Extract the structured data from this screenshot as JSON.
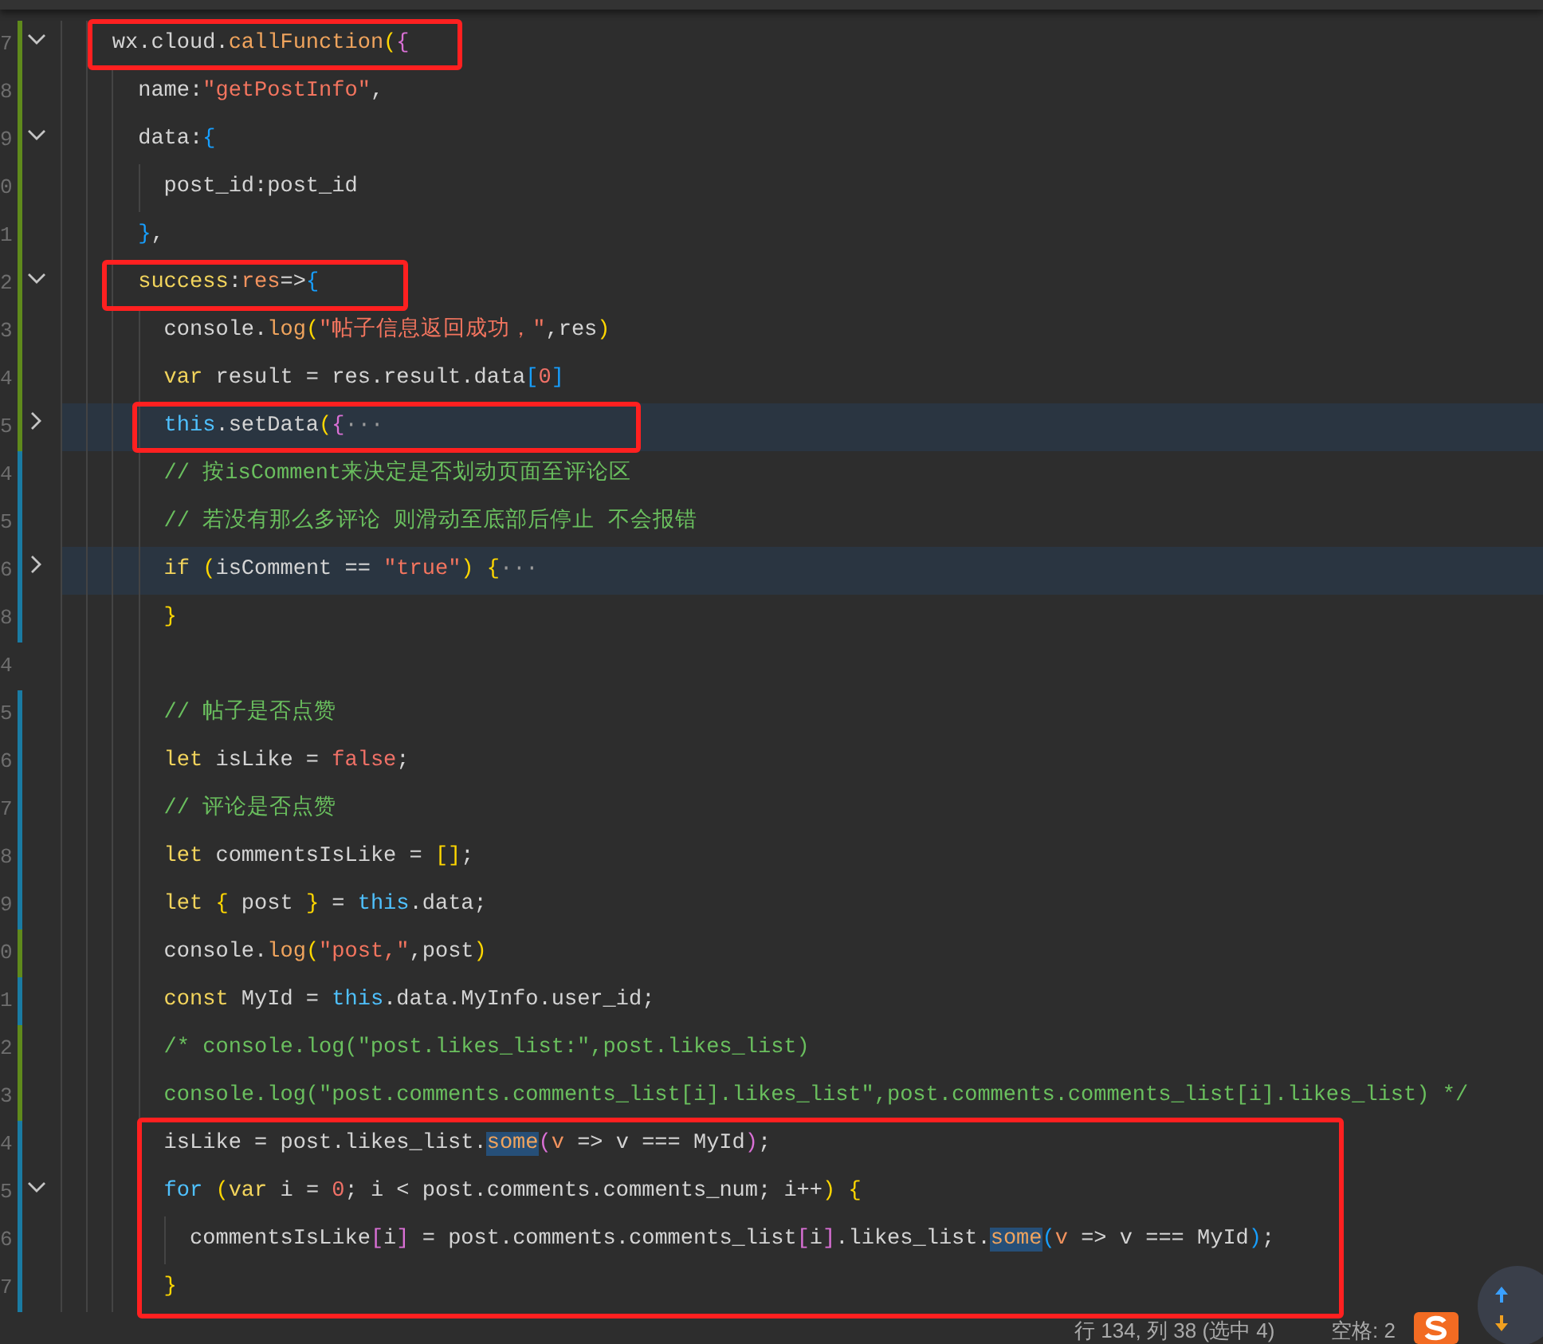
{
  "editor": {
    "lines": [
      {
        "number": "7",
        "folded": false,
        "color": "#5f8a1c",
        "tokens": [
          {
            "kind": "plain",
            "text": "    wx.cloud."
          },
          {
            "kind": "function",
            "text": "callFunction"
          },
          {
            "kind": "bracket1",
            "text": "("
          },
          {
            "kind": "bracket2",
            "text": "{"
          }
        ]
      },
      {
        "number": "8",
        "color": "#5f8a1c",
        "tokens": [
          {
            "kind": "plain",
            "text": "      name:"
          },
          {
            "kind": "string",
            "text": "\"getPostInfo\""
          },
          {
            "kind": "plain",
            "text": ","
          }
        ]
      },
      {
        "number": "9",
        "folded": false,
        "color": "#5f8a1c",
        "tokens": [
          {
            "kind": "plain",
            "text": "      data:"
          },
          {
            "kind": "bracket3",
            "text": "{"
          }
        ]
      },
      {
        "number": "0",
        "color": "#5f8a1c",
        "tokens": [
          {
            "kind": "plain",
            "text": "        post_id:post_id"
          }
        ]
      },
      {
        "number": "1",
        "color": "#5f8a1c",
        "tokens": [
          {
            "kind": "bracket3",
            "text": "      }"
          },
          {
            "kind": "plain",
            "text": ","
          }
        ]
      },
      {
        "number": "2",
        "folded": false,
        "color": "#5f8a1c",
        "tokens": [
          {
            "kind": "keyword",
            "text": "      success"
          },
          {
            "kind": "plain",
            "text": ":"
          },
          {
            "kind": "param",
            "text": "res"
          },
          {
            "kind": "plain",
            "text": "=>"
          },
          {
            "kind": "bracket3",
            "text": "{"
          }
        ]
      },
      {
        "number": "3",
        "color": "#5f8a1c",
        "tokens": [
          {
            "kind": "plain",
            "text": "        console."
          },
          {
            "kind": "function",
            "text": "log"
          },
          {
            "kind": "bracket1",
            "text": "("
          },
          {
            "kind": "string",
            "text": "\"帖子信息返回成功，\""
          },
          {
            "kind": "plain",
            "text": ",res"
          },
          {
            "kind": "bracket1",
            "text": ")"
          }
        ]
      },
      {
        "number": "4",
        "color": "#5f8a1c",
        "tokens": [
          {
            "kind": "keyword",
            "text": "        var"
          },
          {
            "kind": "plain",
            "text": " result = res.result.data"
          },
          {
            "kind": "bracket3",
            "text": "["
          },
          {
            "kind": "number",
            "text": "0"
          },
          {
            "kind": "bracket3",
            "text": "]"
          }
        ]
      },
      {
        "number": "5",
        "folded": true,
        "color": "#5f8a1c",
        "tokens": [
          {
            "kind": "this",
            "text": "        this"
          },
          {
            "kind": "plain",
            "text": ".setData"
          },
          {
            "kind": "bracket1",
            "text": "("
          },
          {
            "kind": "bracket2",
            "text": "{"
          },
          {
            "kind": "ellipsis",
            "text": "···"
          }
        ]
      },
      {
        "number": "4",
        "color": "#1a7ba3",
        "tokens": [
          {
            "kind": "comment",
            "text": "        // 按isComment来决定是否划动页面至评论区"
          }
        ]
      },
      {
        "number": "5",
        "color": "#1a7ba3",
        "tokens": [
          {
            "kind": "comment",
            "text": "        // 若没有那么多评论 则滑动至底部后停止 不会报错"
          }
        ]
      },
      {
        "number": "6",
        "folded": true,
        "color": "#1a7ba3",
        "tokens": [
          {
            "kind": "keyword",
            "text": "        if "
          },
          {
            "kind": "bracket1",
            "text": "("
          },
          {
            "kind": "plain",
            "text": "isComment == "
          },
          {
            "kind": "string",
            "text": "\"true\""
          },
          {
            "kind": "bracket1",
            "text": ") {"
          },
          {
            "kind": "ellipsis",
            "text": "···"
          }
        ]
      },
      {
        "number": "8",
        "color": "#1a7ba3",
        "tokens": [
          {
            "kind": "bracket1",
            "text": "        }"
          }
        ]
      },
      {
        "number": "4"
      },
      {
        "number": "5",
        "color": "#1a7ba3",
        "tokens": [
          {
            "kind": "comment",
            "text": "        // 帖子是否点赞"
          }
        ]
      },
      {
        "number": "6",
        "color": "#1a7ba3",
        "tokens": [
          {
            "kind": "keyword",
            "text": "        let"
          },
          {
            "kind": "plain",
            "text": " isLike = "
          },
          {
            "kind": "number",
            "text": "false"
          },
          {
            "kind": "plain",
            "text": ";"
          }
        ]
      },
      {
        "number": "7",
        "color": "#1a7ba3",
        "tokens": [
          {
            "kind": "comment",
            "text": "        // 评论是否点赞"
          }
        ]
      },
      {
        "number": "8",
        "color": "#1a7ba3",
        "tokens": [
          {
            "kind": "keyword",
            "text": "        let"
          },
          {
            "kind": "plain",
            "text": " commentsIsLike = "
          },
          {
            "kind": "bracket1",
            "text": "[]"
          },
          {
            "kind": "plain",
            "text": ";"
          }
        ]
      },
      {
        "number": "9",
        "color": "#1a7ba3",
        "tokens": [
          {
            "kind": "keyword",
            "text": "        let "
          },
          {
            "kind": "bracket1",
            "text": "{"
          },
          {
            "kind": "plain",
            "text": " post "
          },
          {
            "kind": "bracket1",
            "text": "}"
          },
          {
            "kind": "plain",
            "text": " = "
          },
          {
            "kind": "this",
            "text": "this"
          },
          {
            "kind": "plain",
            "text": ".data;"
          }
        ]
      },
      {
        "number": "0",
        "color": "#5f8a1c",
        "tokens": [
          {
            "kind": "plain",
            "text": "        console."
          },
          {
            "kind": "function",
            "text": "log"
          },
          {
            "kind": "bracket1",
            "text": "("
          },
          {
            "kind": "string",
            "text": "\"post,\""
          },
          {
            "kind": "plain",
            "text": ",post"
          },
          {
            "kind": "bracket1",
            "text": ")"
          }
        ]
      },
      {
        "number": "1",
        "color": "#1a7ba3",
        "tokens": [
          {
            "kind": "keyword",
            "text": "        const"
          },
          {
            "kind": "plain",
            "text": " MyId = "
          },
          {
            "kind": "this",
            "text": "this"
          },
          {
            "kind": "plain",
            "text": ".data.MyInfo.user_id;"
          }
        ]
      },
      {
        "number": "2",
        "color": "#5f8a1c",
        "tokens": [
          {
            "kind": "comment",
            "text": "        /* console.log(\"post.likes_list:\",post.likes_list)"
          }
        ]
      },
      {
        "number": "3",
        "color": "#5f8a1c",
        "tokens": [
          {
            "kind": "comment",
            "text": "        console.log(\"post.comments.comments_list[i].likes_list\",post.comments.comments_list[i].likes_list) */"
          }
        ]
      },
      {
        "number": "4",
        "color": "#1a7ba3",
        "tokens": [
          {
            "kind": "plain",
            "text": "        isLike = post.likes_list."
          },
          {
            "kind": "match",
            "text": "some"
          },
          {
            "kind": "bracket2",
            "text": "("
          },
          {
            "kind": "param",
            "text": "v"
          },
          {
            "kind": "plain",
            "text": " => v === MyId"
          },
          {
            "kind": "bracket2",
            "text": ")"
          },
          {
            "kind": "plain",
            "text": ";"
          }
        ]
      },
      {
        "number": "5",
        "folded": false,
        "color": "#1a7ba3",
        "tokens": [
          {
            "kind": "control",
            "text": "        for "
          },
          {
            "kind": "bracket1",
            "text": "("
          },
          {
            "kind": "keyword",
            "text": "var"
          },
          {
            "kind": "plain",
            "text": " i = "
          },
          {
            "kind": "number",
            "text": "0"
          },
          {
            "kind": "plain",
            "text": "; i < post.comments.comments_num; i++"
          },
          {
            "kind": "bracket1",
            "text": ") {"
          }
        ]
      },
      {
        "number": "6",
        "color": "#1a7ba3",
        "tokens": [
          {
            "kind": "plain",
            "text": "          commentsIsLike"
          },
          {
            "kind": "bracket2",
            "text": "["
          },
          {
            "kind": "plain",
            "text": "i"
          },
          {
            "kind": "bracket2",
            "text": "]"
          },
          {
            "kind": "plain",
            "text": " = post.comments.comments_list"
          },
          {
            "kind": "bracket2",
            "text": "["
          },
          {
            "kind": "plain",
            "text": "i"
          },
          {
            "kind": "bracket2",
            "text": "]"
          },
          {
            "kind": "plain",
            "text": ".likes_list."
          },
          {
            "kind": "match",
            "text": "some"
          },
          {
            "kind": "bracket3",
            "text": "("
          },
          {
            "kind": "param",
            "text": "v"
          },
          {
            "kind": "plain",
            "text": " => v === MyId"
          },
          {
            "kind": "bracket3",
            "text": ")"
          },
          {
            "kind": "plain",
            "text": ";"
          }
        ]
      },
      {
        "number": "7",
        "color": "#1a7ba3",
        "tokens": [
          {
            "kind": "bracket1",
            "text": "        }"
          }
        ]
      }
    ]
  },
  "status_bar": {
    "position": "行 134, 列 38 (选中 4)",
    "indent": "空格: 2"
  }
}
